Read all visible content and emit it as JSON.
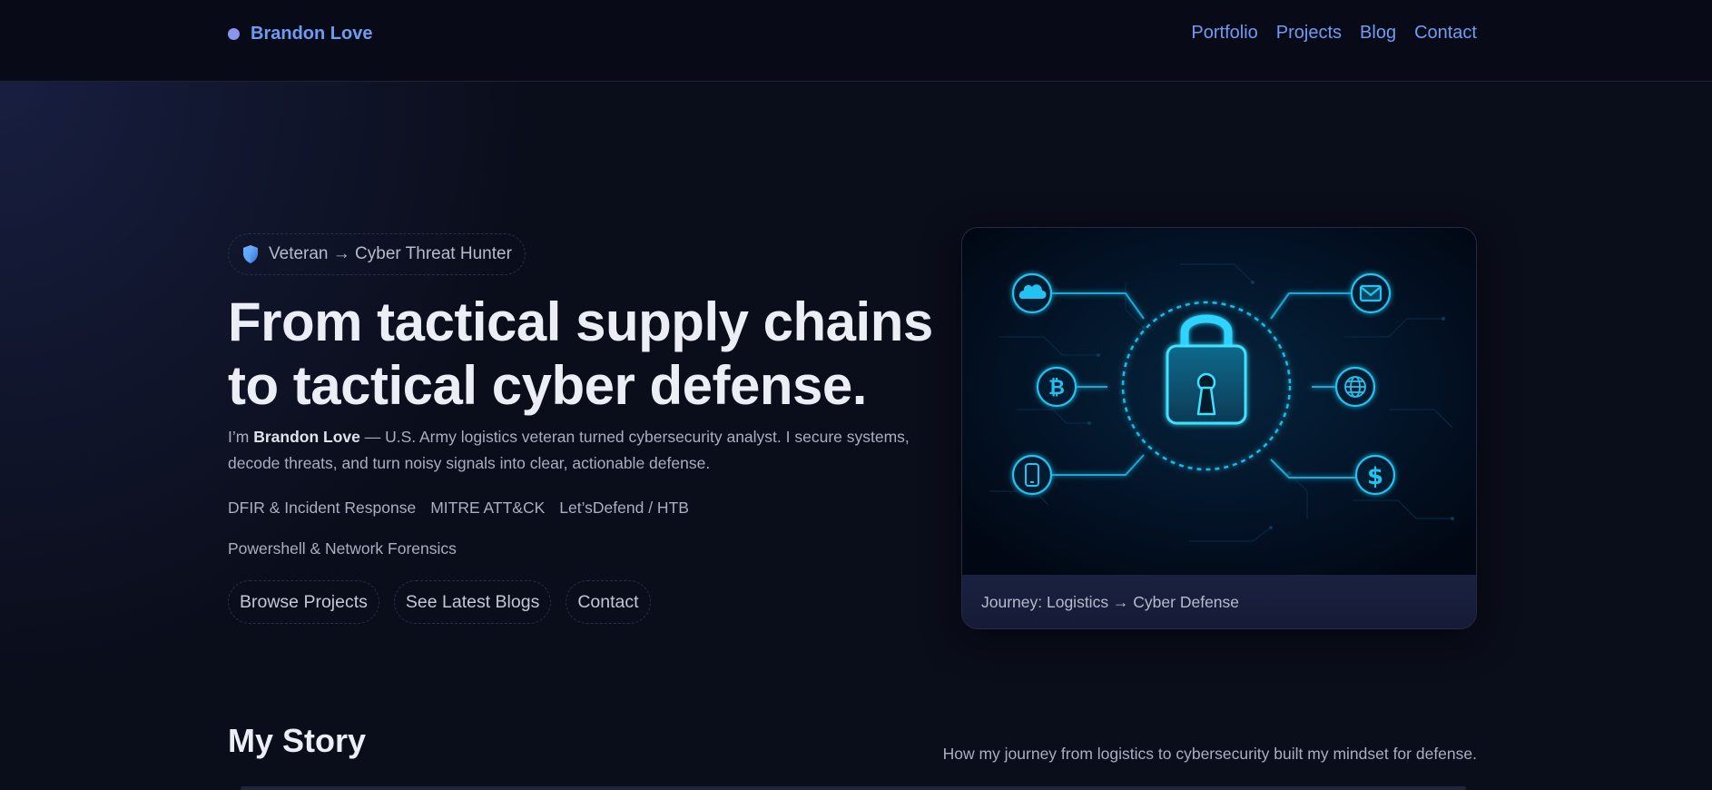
{
  "nav": {
    "brand": "Brandon Love",
    "links": [
      "Portfolio",
      "Projects",
      "Blog",
      "Contact"
    ]
  },
  "hero": {
    "badge": "Veteran → Cyber Threat Hunter",
    "title_line1": "From tactical supply chains",
    "title_line2": "to tactical cyber defense.",
    "intro_prefix": "I’m ",
    "intro_name": "Brandon Love",
    "intro_rest": " — U.S. Army logistics veteran turned cybersecurity analyst. I secure systems, decode threats, and turn noisy signals into clear, actionable defense.",
    "skills_row1": [
      "DFIR & Incident Response",
      "MITRE ATT&CK",
      "Let’sDefend / HTB"
    ],
    "skills_row2": [
      "Powershell & Network Forensics"
    ],
    "buttons": [
      "Browse Projects",
      "See Latest Blogs",
      "Contact"
    ],
    "card_caption": "Journey: Logistics → Cyber Defense"
  },
  "story": {
    "title": "My Story",
    "subtitle": "How my journey from logistics to cybersecurity built my mindset for defense."
  },
  "colors": {
    "background": "#0a0d1a",
    "accent_link": "#6f9cf3",
    "brand_dot": "#8c93f0",
    "neon_cyan": "#19c6f2"
  },
  "icons": [
    "shield-icon",
    "cloud-icon",
    "mail-icon",
    "bitcoin-icon",
    "globe-icon",
    "phone-icon",
    "dollar-icon",
    "padlock-icon"
  ]
}
